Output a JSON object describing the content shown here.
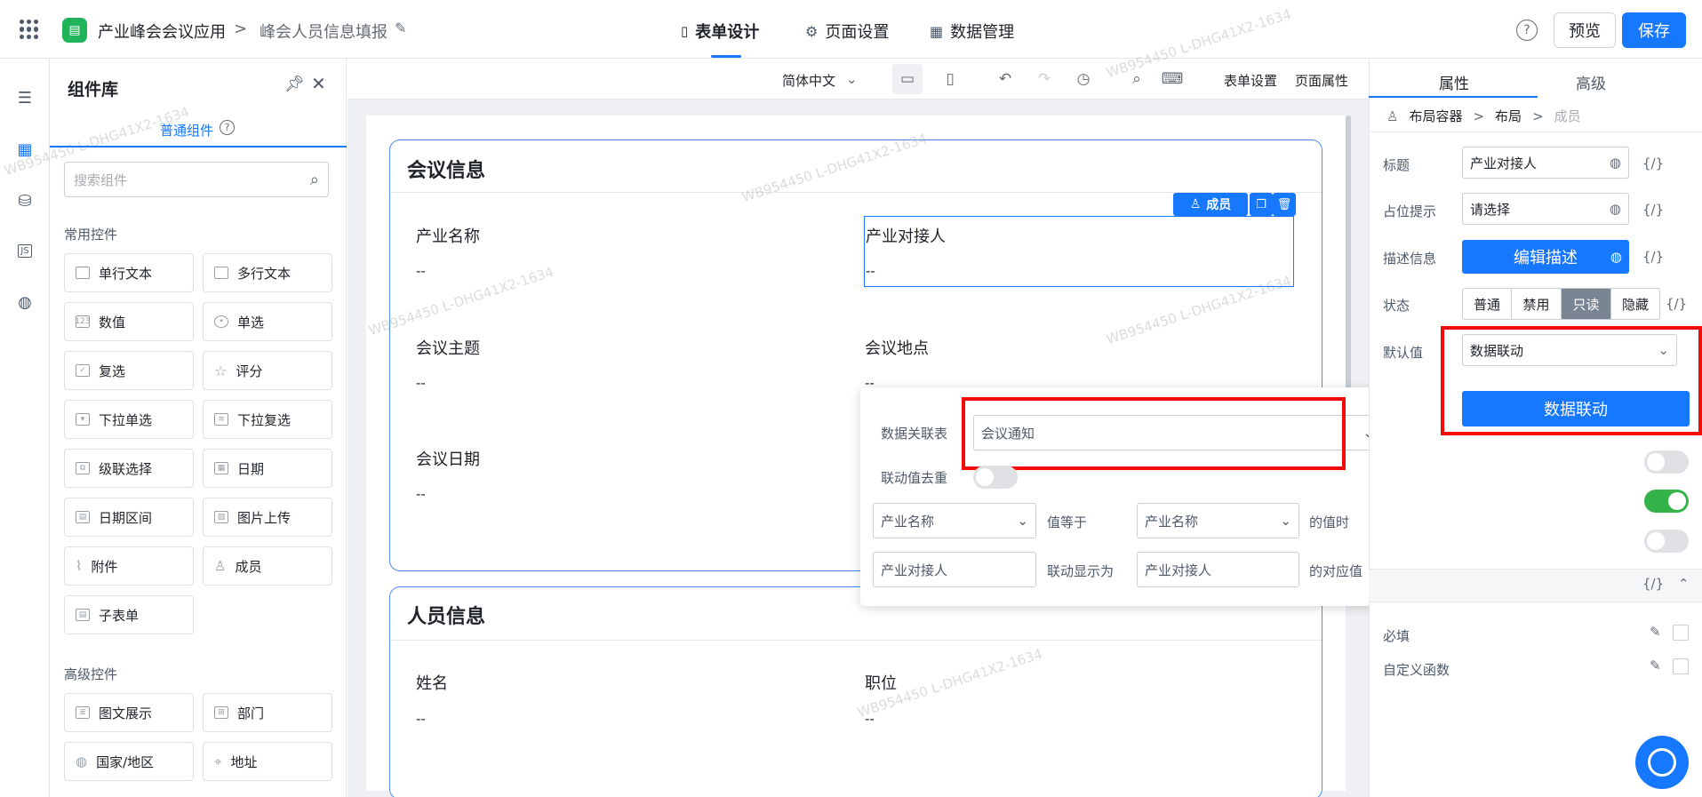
{
  "header": {
    "app_name": "产业峰会会议应用",
    "form_name": "峰会人员信息填报",
    "tabs": [
      "表单设计",
      "页面设置",
      "数据管理"
    ],
    "preview_label": "预览",
    "save_label": "保存"
  },
  "component_panel": {
    "title": "组件库",
    "subtab": "普通组件",
    "search_placeholder": "搜索组件",
    "sections": [
      {
        "title": "常用控件",
        "items": [
          "单行文本",
          "多行文本",
          "数值",
          "单选",
          "复选",
          "评分",
          "下拉单选",
          "下拉复选",
          "级联选择",
          "日期",
          "日期区间",
          "图片上传",
          "附件",
          "成员",
          "子表单"
        ]
      },
      {
        "title": "高级控件",
        "items": [
          "图文展示",
          "部门",
          "国家/地区",
          "地址"
        ]
      }
    ]
  },
  "toolbar": {
    "language": "简体中文",
    "form_settings": "表单设置",
    "page_props": "页面属性"
  },
  "form": {
    "sections": [
      {
        "title": "会议信息",
        "fields": [
          {
            "label": "产业名称",
            "value": "--"
          },
          {
            "label": "产业对接人",
            "value": "--"
          },
          {
            "label": "会议主题",
            "value": "--"
          },
          {
            "label": "会议地点",
            "value": "--"
          },
          {
            "label": "会议日期",
            "value": "--"
          }
        ]
      },
      {
        "title": "人员信息",
        "fields": [
          {
            "label": "姓名",
            "value": "--"
          },
          {
            "label": "职位",
            "value": "--"
          }
        ]
      }
    ],
    "member_tag": "成员"
  },
  "linkage_popover": {
    "table_label": "数据关联表",
    "table_value": "会议通知",
    "dedupe_label": "联动值去重",
    "dedupe_on": false,
    "cond_field": "产业名称",
    "cond_op": "值等于",
    "cond_target": "产业名称",
    "cond_suffix": "的值时",
    "display_field": "产业对接人",
    "display_op": "联动显示为",
    "display_target": "产业对接人",
    "display_suffix": "的对应值"
  },
  "props_panel": {
    "tabs": [
      "属性",
      "高级"
    ],
    "breadcrumb": [
      "布局容器",
      "布局",
      "成员"
    ],
    "title_label": "标题",
    "title_value": "产业对接人",
    "placeholder_label": "占位提示",
    "placeholder_value": "请选择",
    "desc_label": "描述信息",
    "desc_button": "编辑描述",
    "status_label": "状态",
    "status_options": [
      "普通",
      "禁用",
      "只读",
      "隐藏"
    ],
    "status_selected": "只读",
    "default_label": "默认值",
    "default_value": "数据联动",
    "linkage_button": "数据联动",
    "toggles": [
      false,
      true,
      false
    ],
    "required_label": "必填",
    "custom_fn_label": "自定义函数",
    "code_label": "{/}"
  },
  "watermark": "WB954450 L-DHG41X2-1634",
  "colors": {
    "accent": "#1677ff",
    "highlight": "#f50a0a",
    "app_icon": "#1fb459"
  }
}
